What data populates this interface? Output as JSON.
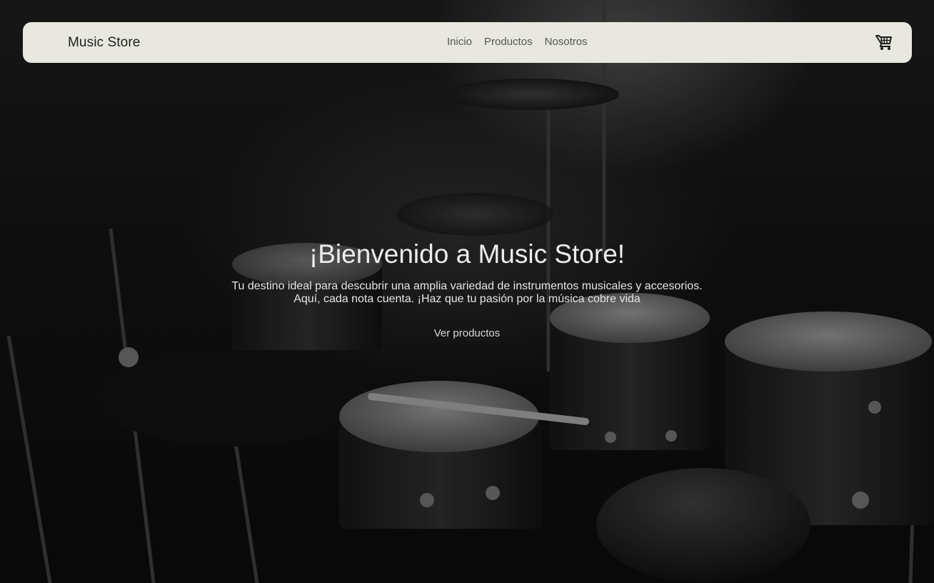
{
  "navbar": {
    "brand": "Music Store",
    "links": [
      "Inicio",
      "Productos",
      "Nosotros"
    ],
    "cart_icon": "shopping-cart-icon"
  },
  "hero": {
    "title": "¡Bienvenido a Music Store!",
    "subtitle_line1": "Tu destino ideal para descubrir una amplia variedad de instrumentos musicales y accesorios.",
    "subtitle_line2": "Aquí, cada nota cuenta. ¡Haz que tu pasión por la música cobre vida",
    "cta": "Ver productos",
    "background": "drum-kit-photo"
  },
  "colors": {
    "navbar_bg": "#e9e8e0",
    "hero_text": "#ececec"
  }
}
